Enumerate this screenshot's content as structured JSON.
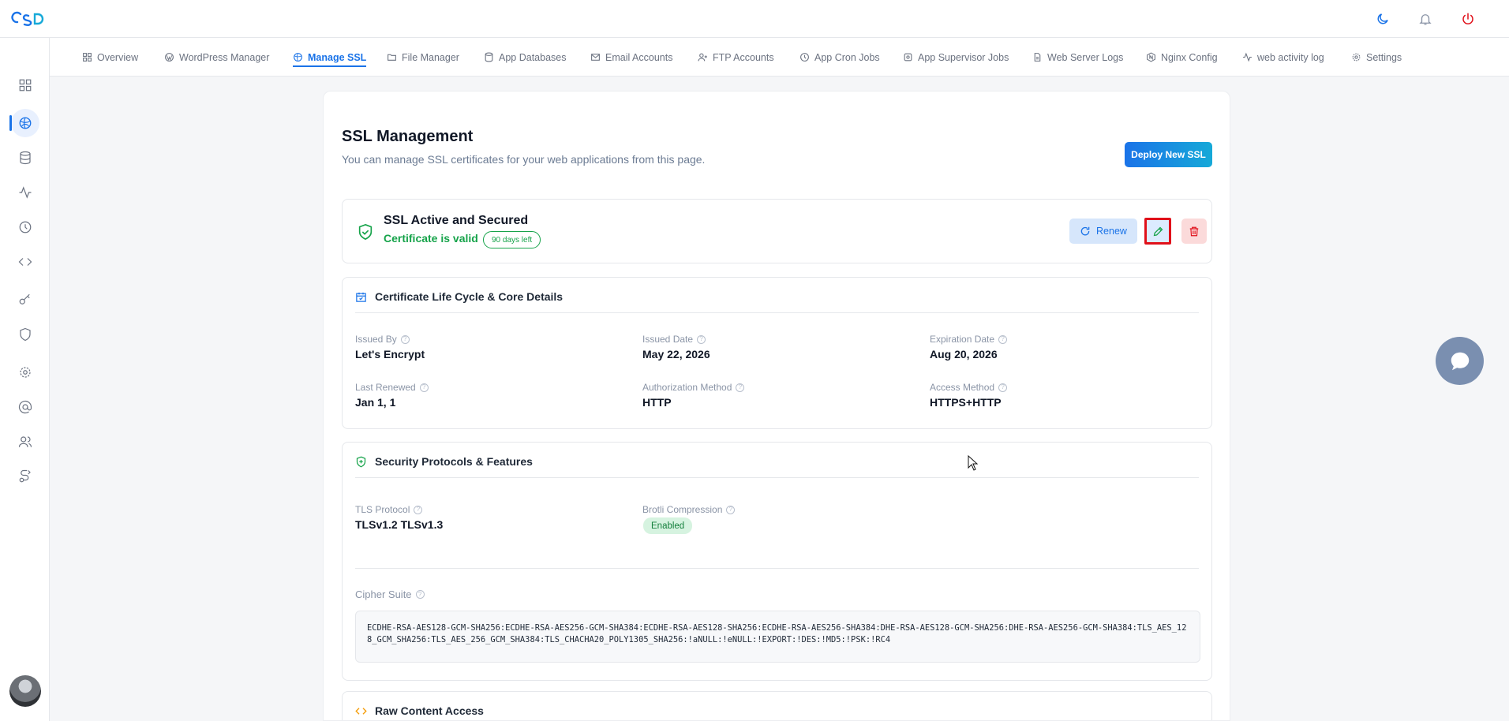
{
  "tabs": [
    {
      "label": "Overview",
      "icon": "grid-icon"
    },
    {
      "label": "WordPress Manager",
      "icon": "wordpress-icon"
    },
    {
      "label": "Manage SSL",
      "icon": "globe-icon"
    },
    {
      "label": "File Manager",
      "icon": "folder-icon"
    },
    {
      "label": "App Databases",
      "icon": "database-icon"
    },
    {
      "label": "Email Accounts",
      "icon": "mail-icon"
    },
    {
      "label": "FTP Accounts",
      "icon": "user-plus-icon"
    },
    {
      "label": "App Cron Jobs",
      "icon": "clock-icon"
    },
    {
      "label": "App Supervisor Jobs",
      "icon": "cog-icon"
    },
    {
      "label": "Web Server Logs",
      "icon": "file-icon"
    },
    {
      "label": "Nginx Config",
      "icon": "hexagon-icon"
    },
    {
      "label": "web activity log",
      "icon": "activity-icon"
    },
    {
      "label": "Settings",
      "icon": "gear-icon"
    }
  ],
  "page": {
    "title": "SSL Management",
    "subtitle": "You can manage SSL certificates for your web applications from this page.",
    "deploy_label": "Deploy New SSL"
  },
  "status": {
    "title": "SSL Active and Secured",
    "valid": "Certificate is valid",
    "days_left": "90 days left",
    "renew_label": "Renew"
  },
  "lifecycle": {
    "heading": "Certificate Life Cycle & Core Details",
    "issued_by_label": "Issued By",
    "issued_by": "Let's Encrypt",
    "issued_date_label": "Issued Date",
    "issued_date": "May 22, 2026",
    "expiration_label": "Expiration Date",
    "expiration": "Aug 20, 2026",
    "last_renewed_label": "Last Renewed",
    "last_renewed": "Jan 1, 1",
    "auth_method_label": "Authorization Method",
    "auth_method": "HTTP",
    "access_method_label": "Access Method",
    "access_method": "HTTPS+HTTP"
  },
  "security": {
    "heading": "Security Protocols & Features",
    "tls_label": "TLS Protocol",
    "tls": "TLSv1.2 TLSv1.3",
    "brotli_label": "Brotli Compression",
    "brotli": "Enabled",
    "cipher_label": "Cipher Suite",
    "cipher": "ECDHE-RSA-AES128-GCM-SHA256:ECDHE-RSA-AES256-GCM-SHA384:ECDHE-RSA-AES128-SHA256:ECDHE-RSA-AES256-SHA384:DHE-RSA-AES128-GCM-SHA256:DHE-RSA-AES256-GCM-SHA384:TLS_AES_128_GCM_SHA256:TLS_AES_256_GCM_SHA384:TLS_CHACHA20_POLY1305_SHA256:!aNULL:!eNULL:!EXPORT:!DES:!MD5:!PSK:!RC4"
  },
  "raw": {
    "heading": "Raw Content Access"
  },
  "colors": {
    "accent": "#1a73e8",
    "success": "#16a34a",
    "danger": "#e0101a"
  }
}
